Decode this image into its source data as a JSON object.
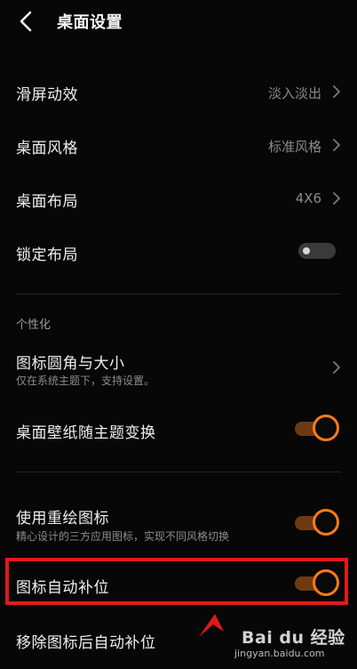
{
  "header": {
    "title": "桌面设置"
  },
  "rows": {
    "scroll_effect": {
      "label": "滑屏动效",
      "value": "淡入淡出"
    },
    "desktop_style": {
      "label": "桌面风格",
      "value": "标准风格"
    },
    "desktop_layout": {
      "label": "桌面布局",
      "value": "4X6"
    },
    "lock_layout": {
      "label": "锁定布局",
      "enabled": false
    }
  },
  "section_personalize": {
    "title": "个性化",
    "icon_corner": {
      "label": "图标圆角与大小",
      "sub": "仅在系统主题下，支持设置。"
    },
    "wallpaper_theme": {
      "label": "桌面壁纸随主题变换",
      "enabled": true
    },
    "redraw_icons": {
      "label": "使用重绘图标",
      "sub": "精心设计的三方应用图标，实现不同风格切换",
      "enabled": true
    },
    "auto_fill": {
      "label": "图标自动补位",
      "enabled": true
    },
    "remove_auto_fill": {
      "label": "移除图标后自动补位"
    }
  },
  "watermark": {
    "logo": "Bai du 经验",
    "url": "jingyan.baidu.com"
  },
  "colors": {
    "accent": "#ff7a1a",
    "highlight": "#e01a1a",
    "background": "#070707"
  }
}
